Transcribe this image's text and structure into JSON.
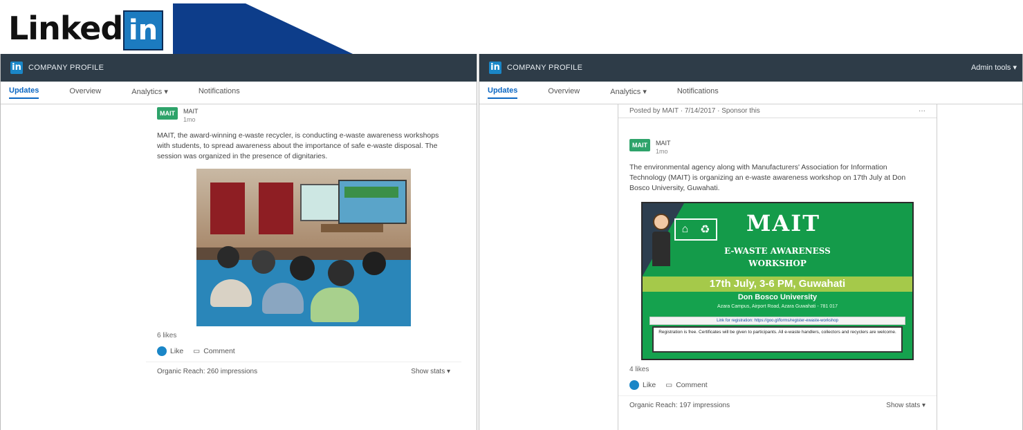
{
  "logo": {
    "text": "Linked",
    "box": "in"
  },
  "left_panel": {
    "topbar": {
      "icon": "in",
      "title": "COMPANY PROFILE"
    },
    "tabs": [
      "Updates",
      "Overview",
      "Analytics ▾",
      "Notifications"
    ],
    "post": {
      "company": "MAIT",
      "time": "1mo",
      "body": "MAIT, the award-winning e-waste recycler, is conducting e-waste awareness workshops with students, to spread awareness about the importance of safe e-waste disposal. The session was organized in the presence of dignitaries.",
      "likes": "6 likes",
      "like_label": "Like",
      "comment_label": "Comment",
      "impressions": "Organic Reach: 260 impressions",
      "show_stats": "Show stats ▾"
    }
  },
  "right_panel": {
    "topbar": {
      "icon": "in",
      "title": "COMPANY PROFILE",
      "admin": "Admin tools ▾"
    },
    "tabs": [
      "Updates",
      "Overview",
      "Analytics ▾",
      "Notifications"
    ],
    "sponsor_line": "Posted by MAIT · 7/14/2017 · Sponsor this",
    "sponsor_more": "···",
    "post": {
      "company": "MAIT",
      "time": "1mo",
      "body": "The environmental agency along with Manufacturers' Association for Information Technology (MAIT) is organizing an e-waste awareness workshop on 17th July at Don Bosco University, Guwahati.",
      "poster": {
        "brand": "MAIT",
        "title1": "E-WASTE AWARENESS",
        "title2": "WORKSHOP",
        "date": "17th July, 3-6 PM, Guwahati",
        "venue": "Don Bosco University",
        "address": "Azara Campus, Airport Road, Azara Guwahati - 781 017",
        "registration": "Link for registration: https://goo.gl/forms/register-ewaste-workshop",
        "note": "Registration is free. Certificates will be given to participants. All e-waste handlers, collectors and recyclers are welcome."
      },
      "likes": "4 likes",
      "like_label": "Like",
      "comment_label": "Comment",
      "impressions": "Organic Reach: 197 impressions",
      "show_stats": "Show stats ▾"
    }
  }
}
